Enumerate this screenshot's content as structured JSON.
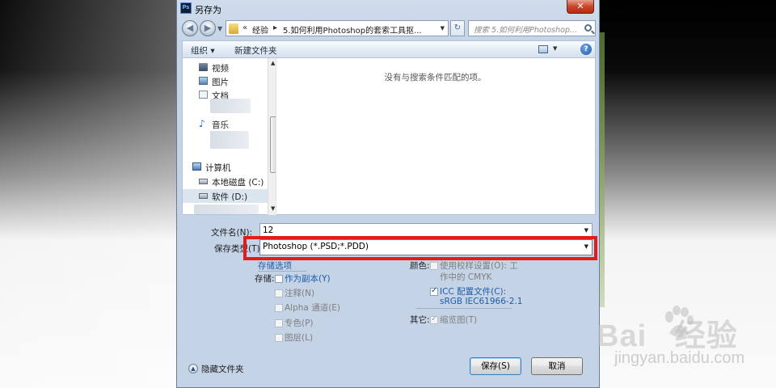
{
  "window": {
    "title": "另存为",
    "app_icon_text": "Ps",
    "close_glyph": "✕"
  },
  "nav": {
    "back_glyph": "◀",
    "forward_glyph": "▶",
    "breadcrumb_prefix": "«",
    "breadcrumb_items": [
      "经验",
      "5.如何利用Photoshop的套索工具抠..."
    ],
    "refresh_glyph": "↻",
    "search_placeholder": "搜索 5.如何利用Photoshop..."
  },
  "cmdbar": {
    "organize_label": "组织 ▾",
    "new_folder_label": "新建文件夹",
    "help_glyph": "?"
  },
  "nav_pane": {
    "items": [
      {
        "label": "视频",
        "icon": "video-icon"
      },
      {
        "label": "图片",
        "icon": "pictures-icon"
      },
      {
        "label": "文档",
        "icon": "documents-icon"
      },
      {
        "label": "音乐",
        "icon": "music-icon"
      },
      {
        "label": "计算机",
        "icon": "computer-icon"
      },
      {
        "label": "本地磁盘 (C:)",
        "icon": "drive-icon"
      },
      {
        "label": "软件 (D:)",
        "icon": "drive-icon"
      }
    ]
  },
  "file_list": {
    "empty_message": "没有与搜索条件匹配的项。"
  },
  "fields": {
    "filename_label": "文件名(N):",
    "filename_value": "12",
    "filetype_label": "保存类型(T):",
    "filetype_value": "Photoshop (*.PSD;*.PDD)"
  },
  "options": {
    "save_options_title": "存储选项",
    "save_label": "存储:",
    "as_copy": "作为副本(Y)",
    "notes": "注释(N)",
    "alpha": "Alpha 通道(E)",
    "spot": "专色(P)",
    "layers": "图层(L)",
    "color_label": "颜色:",
    "proof_line1": "使用校样设置(O):  工",
    "proof_line2": "作中的 CMYK",
    "icc_line1": "ICC 配置文件(C):",
    "icc_line2": "sRGB IEC61966-2.1",
    "other_label": "其它:",
    "thumbnail": "缩览图(T)"
  },
  "footer": {
    "hide_folders": "隐藏文件夹",
    "save_button": "保存(S)",
    "cancel_button": "取消"
  },
  "colors": {
    "highlight": "#e21b1b",
    "link": "#1e5da8"
  }
}
